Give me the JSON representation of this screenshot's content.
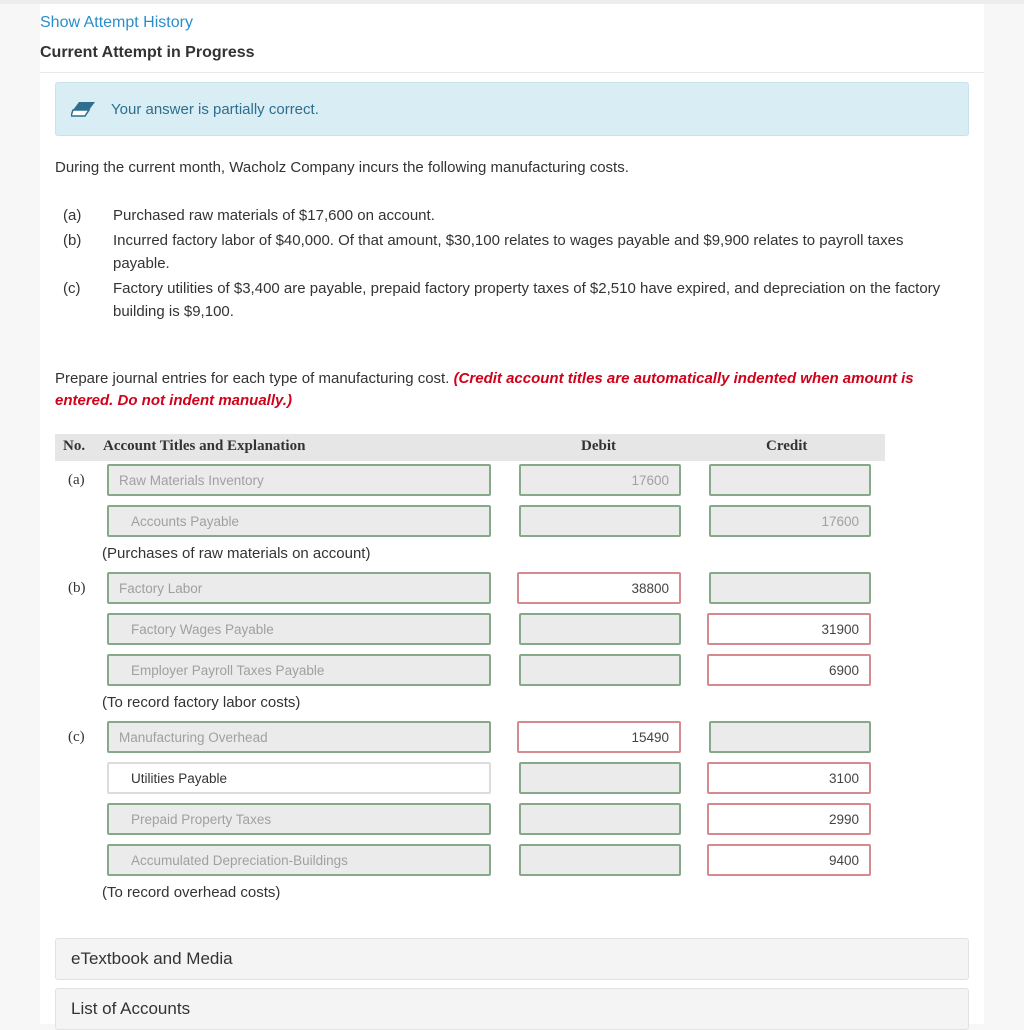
{
  "header": {
    "history_link": "Show Attempt History",
    "attempt_title": "Current Attempt in Progress"
  },
  "feedback": {
    "icon": "eraser-icon",
    "message": "Your answer is partially correct.",
    "color": "#d9edf5"
  },
  "problem": {
    "intro": "During the current month, Wacholz Company incurs the following manufacturing costs.",
    "items": [
      {
        "label": "(a)",
        "text": "Purchased raw materials of $17,600 on account."
      },
      {
        "label": "(b)",
        "text": "Incurred factory labor of $40,000. Of that amount, $30,100 relates to wages payable and $9,900 relates to payroll taxes payable."
      },
      {
        "label": "(c)",
        "text": "Factory utilities of $3,400 are payable, prepaid factory property taxes of $2,510 have expired, and depreciation on the factory building is $9,100."
      }
    ],
    "instruction": "Prepare journal entries for each type of manufacturing cost.",
    "instruction_note": "(Credit account titles are automatically indented when amount is entered. Do not indent manually.)"
  },
  "table": {
    "headers": {
      "no": "No.",
      "account": "Account Titles and Explanation",
      "debit": "Debit",
      "credit": "Credit"
    },
    "entries": [
      {
        "no": "(a)",
        "lines": [
          {
            "account": "Raw Materials Inventory",
            "debit": "17600",
            "credit": "",
            "account_status": "correct",
            "debit_status": "correct",
            "credit_status": "correct"
          },
          {
            "account": "Accounts Payable",
            "debit": "",
            "credit": "17600",
            "account_status": "correct",
            "debit_status": "correct",
            "credit_status": "correct"
          }
        ],
        "explanation": "(Purchases of raw materials on account)"
      },
      {
        "no": "(b)",
        "lines": [
          {
            "account": "Factory Labor",
            "debit": "38800",
            "credit": "",
            "account_status": "correct",
            "debit_status": "incorrect",
            "credit_status": "correct"
          },
          {
            "account": "Factory Wages Payable",
            "debit": "",
            "credit": "31900",
            "account_status": "correct",
            "debit_status": "correct",
            "credit_status": "incorrect"
          },
          {
            "account": "Employer Payroll Taxes Payable",
            "debit": "",
            "credit": "6900",
            "account_status": "correct",
            "debit_status": "correct",
            "credit_status": "incorrect"
          }
        ],
        "explanation": "(To record factory labor costs)"
      },
      {
        "no": "(c)",
        "lines": [
          {
            "account": "Manufacturing Overhead",
            "debit": "15490",
            "credit": "",
            "account_status": "correct",
            "debit_status": "incorrect",
            "credit_status": "correct"
          },
          {
            "account": "Utilities Payable",
            "debit": "",
            "credit": "3100",
            "account_status": "editable",
            "debit_status": "correct",
            "credit_status": "incorrect"
          },
          {
            "account": "Prepaid Property Taxes",
            "debit": "",
            "credit": "2990",
            "account_status": "correct",
            "debit_status": "correct",
            "credit_status": "incorrect"
          },
          {
            "account": "Accumulated Depreciation-Buildings",
            "debit": "",
            "credit": "9400",
            "account_status": "correct",
            "debit_status": "correct",
            "credit_status": "incorrect"
          }
        ],
        "explanation": "(To record overhead costs)"
      }
    ]
  },
  "panels": [
    {
      "label": "eTextbook and Media"
    },
    {
      "label": "List of Accounts"
    }
  ],
  "colors": {
    "link": "#2a8fc9",
    "correct_border": "#86a98a",
    "incorrect_border": "#d48a8f",
    "note_red": "#d0021b"
  }
}
